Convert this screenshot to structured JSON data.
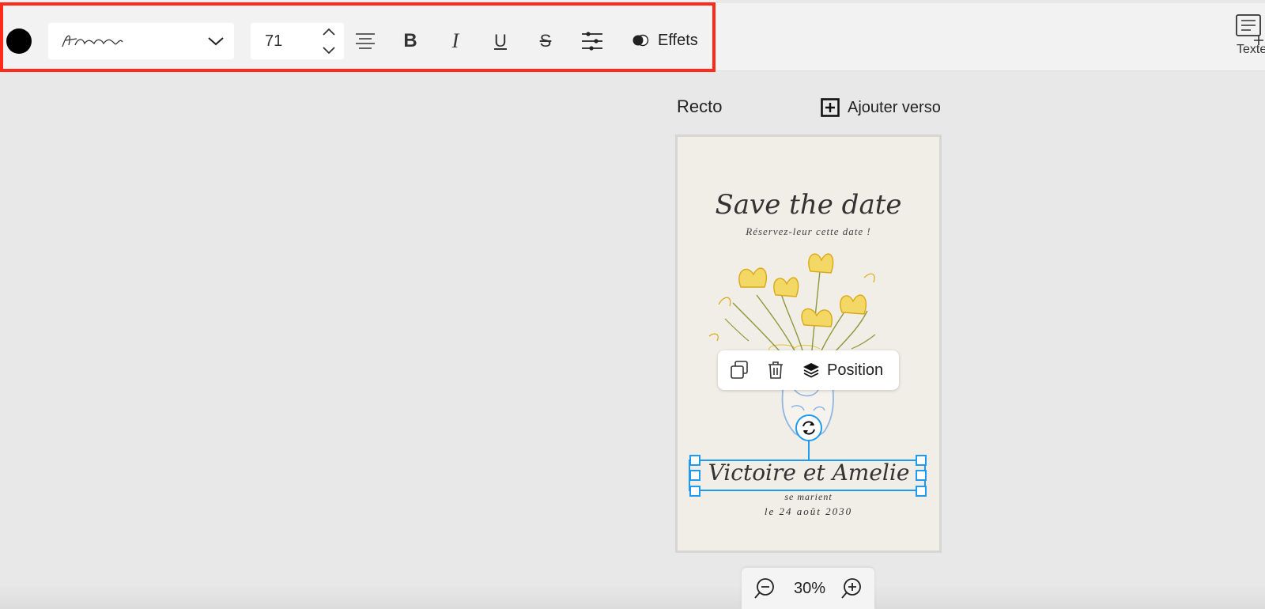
{
  "toolbar": {
    "color": "#000000",
    "font_name": "Amsterdam script",
    "font_size": "71",
    "effects_label": "Effets",
    "icons": [
      "align-center-icon",
      "bold-icon",
      "italic-icon",
      "underline-icon",
      "strikethrough-icon",
      "spacing-settings-icon",
      "effects-toggle-icon"
    ],
    "bold_glyph": "B",
    "italic_glyph": "I",
    "underline_glyph": "U",
    "strike_glyph": "S"
  },
  "right_panel": {
    "texte_label": "Texte"
  },
  "canvas": {
    "side_label": "Recto",
    "add_back_label": "Ajouter verso",
    "zoom": "30%"
  },
  "card": {
    "title": "Save the date",
    "subtitle": "Réservez-leur cette date !",
    "names": "Victoire et Amelie",
    "announcement": "se marient",
    "date": "le 24 août 2030",
    "flower_color": "#e8c234",
    "vase_color": "#8fb6de"
  },
  "context_menu": {
    "position_label": "Position"
  },
  "colors": {
    "selection": "#1e9af0",
    "highlight_border": "#ff2a1a"
  }
}
